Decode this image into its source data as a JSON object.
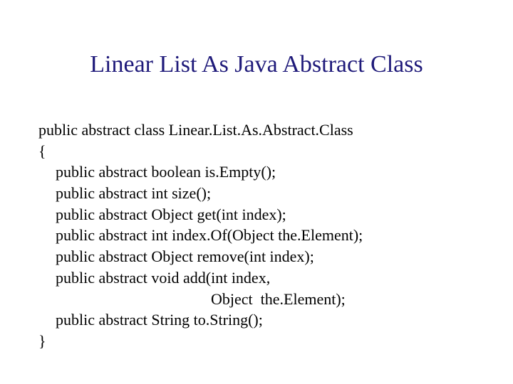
{
  "title": "Linear List As Java Abstract Class",
  "code": {
    "l1": "public abstract class Linear.List.As.Abstract.Class",
    "l2": "{",
    "l3": "public abstract boolean is.Empty();",
    "l4": "public abstract int size();",
    "l5": "public abstract Object get(int index);",
    "l6": "public abstract int index.Of(Object the.Element);",
    "l7": "public abstract Object remove(int index);",
    "l8": "public abstract void add(int index,",
    "l9": "Object  the.Element);",
    "l10": "public abstract String to.String();",
    "l11": "}"
  }
}
